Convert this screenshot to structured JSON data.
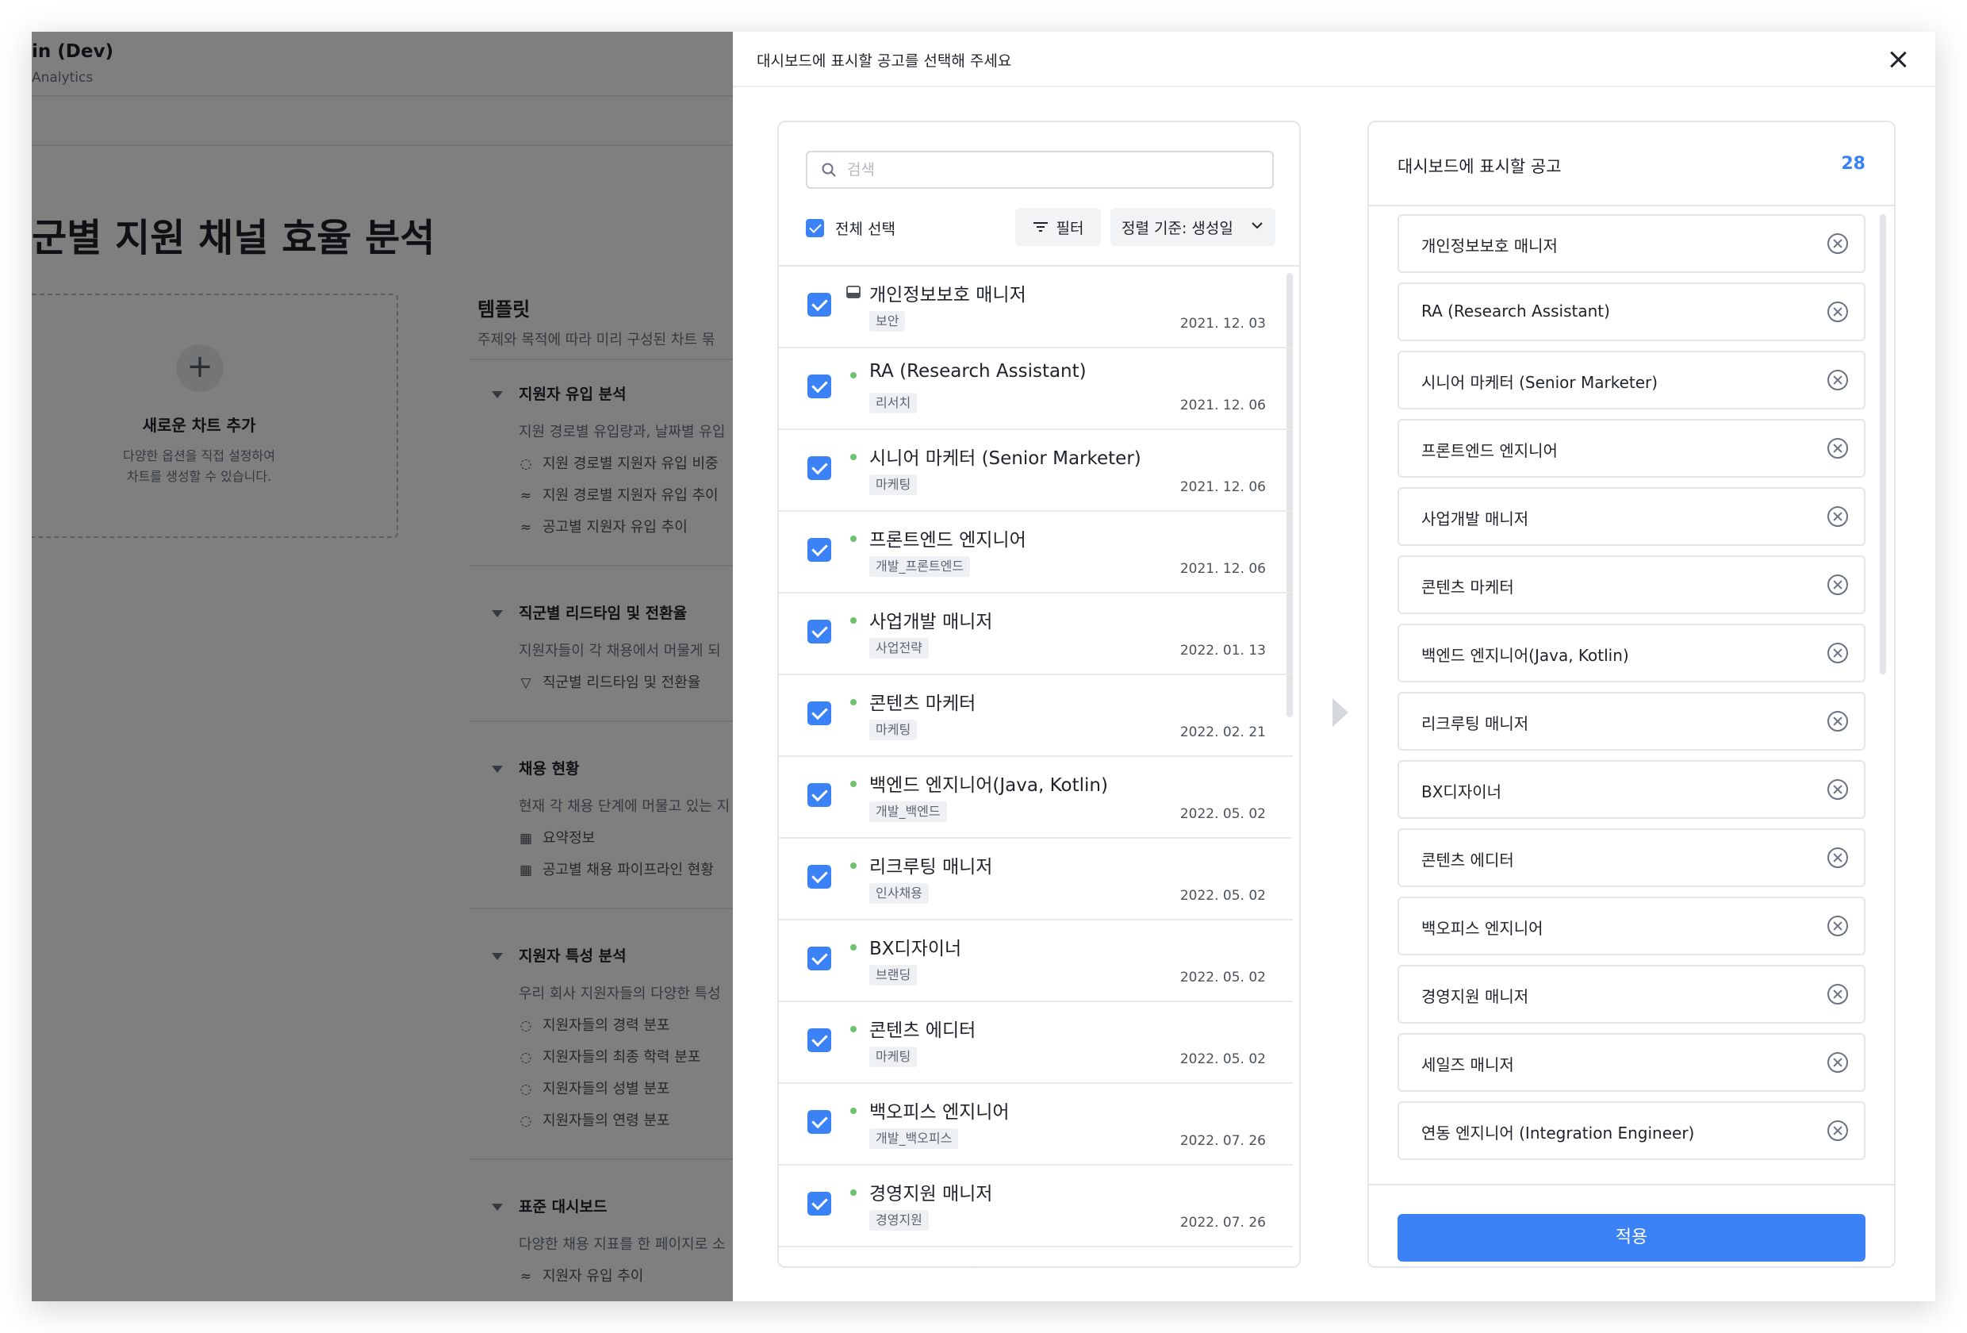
{
  "background": {
    "app_title": "in (Dev)",
    "app_subtitle": "Analytics",
    "page_title": "군별 지원 채널 효율 분석",
    "new_chart": {
      "title": "새로운 차트 추가",
      "desc_line1": "다양한 옵션을 직접 설정하여",
      "desc_line2": "차트를 생성할 수 있습니다."
    },
    "templates_title": "템플릿",
    "templates_desc": "주제와 목적에 따라 미리 구성된 차트 묶",
    "sections": [
      {
        "title": "지원자 유입 분석",
        "desc": "지원 경로별 유입량과, 날짜별 유입",
        "items": [
          {
            "icon": "donut-chart-icon",
            "label": "지원 경로별 지원자 유입 비중"
          },
          {
            "icon": "line-chart-icon",
            "label": "지원 경로별 지원자 유입 추이"
          },
          {
            "icon": "line-chart-icon",
            "label": "공고별 지원자 유입 추이"
          }
        ]
      },
      {
        "title": "직군별 리드타임 및 전환율",
        "desc": "지원자들이 각 채용에서 머물게 되",
        "items": [
          {
            "icon": "funnel-icon",
            "label": "직군별 리드타임 및 전환율"
          }
        ]
      },
      {
        "title": "채용 현황",
        "desc": "현재 각 채용 단계에 머물고 있는 지",
        "items": [
          {
            "icon": "table-icon",
            "label": "요약정보"
          },
          {
            "icon": "table-icon",
            "label": "공고별 채용 파이프라인 현황"
          }
        ]
      },
      {
        "title": "지원자 특성 분석",
        "desc": "우리 회사 지원자들의 다양한 특성",
        "items": [
          {
            "icon": "donut-chart-icon",
            "label": "지원자들의 경력 분포"
          },
          {
            "icon": "donut-chart-icon",
            "label": "지원자들의 최종 학력 분포"
          },
          {
            "icon": "donut-chart-icon",
            "label": "지원자들의 성별 분포"
          },
          {
            "icon": "donut-chart-icon",
            "label": "지원자들의 연령 분포"
          }
        ]
      },
      {
        "title": "표준 대시보드",
        "desc": "다양한 채용 지표를 한 페이지로 소",
        "items": [
          {
            "icon": "line-chart-icon",
            "label": "지원자 유입 추이"
          }
        ]
      }
    ]
  },
  "drawer": {
    "title": "대시보드에 표시할 공고를 선택해 주세요",
    "search": {
      "placeholder": "검색",
      "value": ""
    },
    "select_all_label": "전체 선택",
    "filter_label": "필터",
    "sort_label": "정렬 기준: 생성일",
    "jobs": [
      {
        "title": "개인정보보호 매니저",
        "tag": "보안",
        "date": "2021. 12. 03",
        "status": "inbox"
      },
      {
        "title": "RA (Research Assistant)",
        "tag": "리서치",
        "date": "2021. 12. 06",
        "status": "open"
      },
      {
        "title": "시니어 마케터 (Senior Marketer)",
        "tag": "마케팅",
        "date": "2021. 12. 06",
        "status": "open"
      },
      {
        "title": "프론트엔드 엔지니어",
        "tag": "개발_프론트엔드",
        "date": "2021. 12. 06",
        "status": "open"
      },
      {
        "title": "사업개발 매니저",
        "tag": "사업전략",
        "date": "2022. 01. 13",
        "status": "open"
      },
      {
        "title": "콘텐츠 마케터",
        "tag": "마케팅",
        "date": "2022. 02. 21",
        "status": "open"
      },
      {
        "title": "백엔드 엔지니어(Java, Kotlin)",
        "tag": "개발_백엔드",
        "date": "2022. 05. 02",
        "status": "open"
      },
      {
        "title": "리크루팅 매니저",
        "tag": "인사채용",
        "date": "2022. 05. 02",
        "status": "open"
      },
      {
        "title": "BX디자이너",
        "tag": "브랜딩",
        "date": "2022. 05. 02",
        "status": "open"
      },
      {
        "title": "콘텐츠 에디터",
        "tag": "마케팅",
        "date": "2022. 05. 02",
        "status": "open"
      },
      {
        "title": "백오피스 엔지니어",
        "tag": "개발_백오피스",
        "date": "2022. 07. 26",
        "status": "open"
      },
      {
        "title": "경영지원 매니저",
        "tag": "경영지원",
        "date": "2022. 07. 26",
        "status": "open"
      },
      {
        "title": "세일즈 매니저",
        "tag": "",
        "date": "",
        "status": "open"
      }
    ],
    "selected_title": "대시보드에 표시할 공고",
    "selected_count": "28",
    "selected": [
      "개인정보보호 매니저",
      "RA (Research Assistant)",
      "시니어 마케터 (Senior Marketer)",
      "프론트엔드 엔지니어",
      "사업개발 매니저",
      "콘텐츠 마케터",
      "백엔드 엔지니어(Java, Kotlin)",
      "리크루팅 매니저",
      "BX디자이너",
      "콘텐츠 에디터",
      "백오피스 엔지니어",
      "경영지원 매니저",
      "세일즈 매니저",
      "연동 엔지니어 (Integration Engineer)"
    ],
    "apply_label": "적용",
    "colors": {
      "accent": "#3b82f6",
      "status_open": "#6cc36c",
      "overlay": "rgba(0,0,0,0.5)"
    }
  }
}
